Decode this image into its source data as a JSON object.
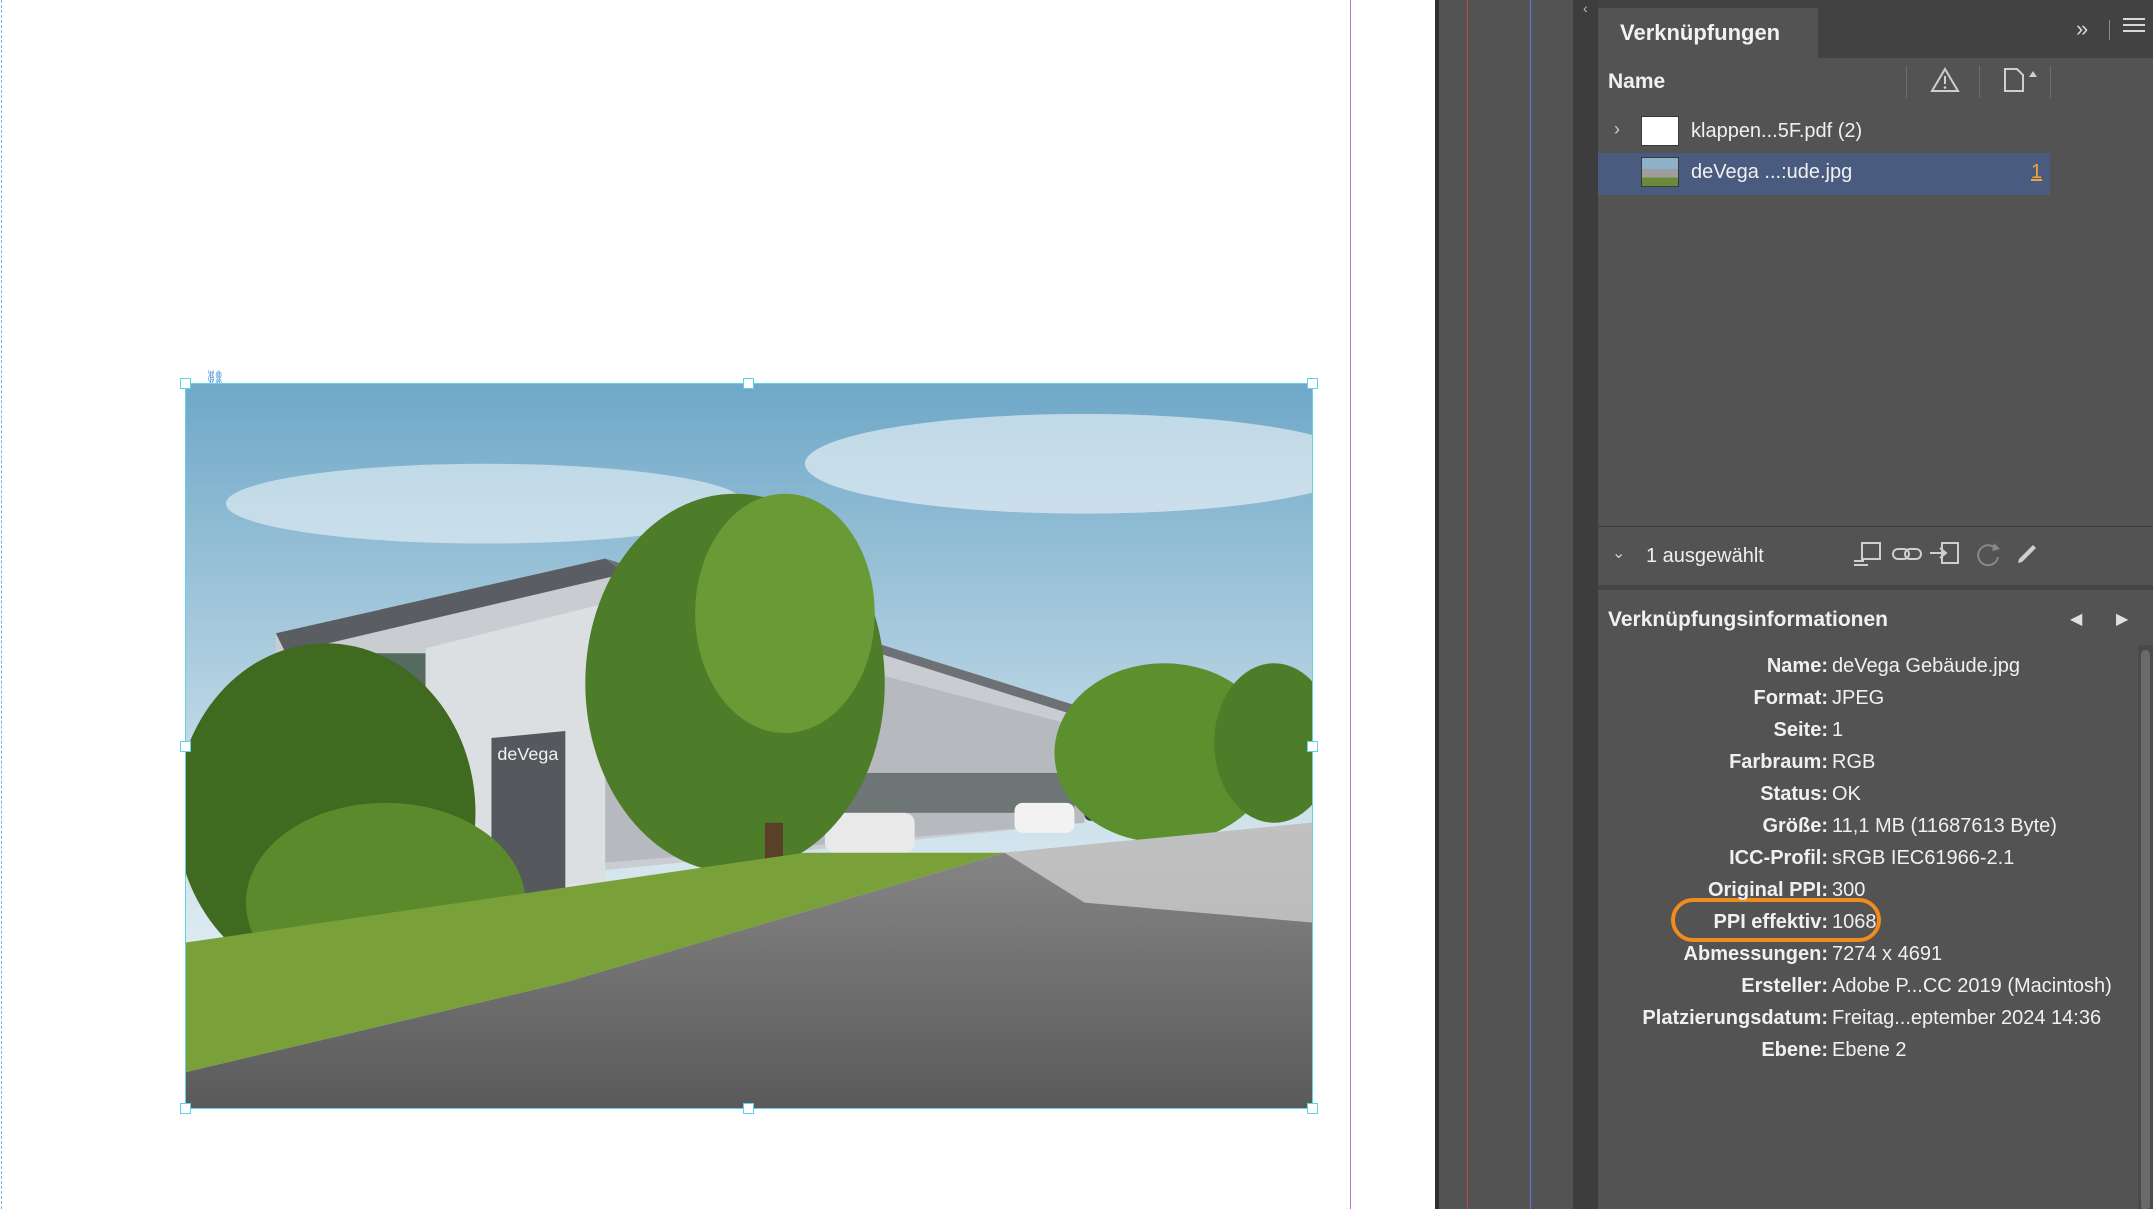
{
  "panel": {
    "tab_title": "Verknüpfungen",
    "column_name": "Name",
    "files": [
      {
        "name": "klappen...5F.pdf (2)",
        "page": ""
      },
      {
        "name": "deVega ...:ude.jpg",
        "page": "1"
      }
    ],
    "selection_label": "1 ausgewählt",
    "info_title": "Verknüpfungsinformationen",
    "info": [
      {
        "key": "Name:",
        "value": "deVega Gebäude.jpg"
      },
      {
        "key": "Format:",
        "value": "JPEG"
      },
      {
        "key": "Seite:",
        "value": "1"
      },
      {
        "key": "Farbraum:",
        "value": "RGB"
      },
      {
        "key": "Status:",
        "value": "OK"
      },
      {
        "key": "Größe:",
        "value": "11,1 MB (11687613 Byte)"
      },
      {
        "key": "ICC-Profil:",
        "value": "sRGB IEC61966-2.1"
      },
      {
        "key": "Original PPI:",
        "value": "300"
      },
      {
        "key": "PPI effektiv:",
        "value": "1068"
      },
      {
        "key": "Abmessungen:",
        "value": "7274 x 4691"
      },
      {
        "key": "Ersteller:",
        "value": "Adobe P...CC 2019 (Macintosh)"
      },
      {
        "key": "Platzierungsdatum:",
        "value": "Freitag...eptember 2024 14:36"
      },
      {
        "key": "Ebene:",
        "value": "Ebene 2"
      }
    ]
  },
  "document": {
    "image_sign_text": "deVega"
  },
  "colors": {
    "panel_bg": "#535353",
    "selection_bg": "#4a5b80",
    "highlight_ring": "#f08c1e",
    "frame_border": "#5fd4e6",
    "page_number": "#f0a53c"
  },
  "icons": {
    "expand": "chevron-right-icon",
    "collapse": "chevron-down-icon",
    "missing": "warning-triangle-icon",
    "page": "page-icon",
    "link": "chain-link-icon",
    "relink": "relink-icon",
    "goto": "goto-link-icon",
    "update": "refresh-icon",
    "edit": "pencil-icon",
    "menu": "hamburger-menu-icon",
    "collapse_panel": "double-chevron-right-icon"
  }
}
